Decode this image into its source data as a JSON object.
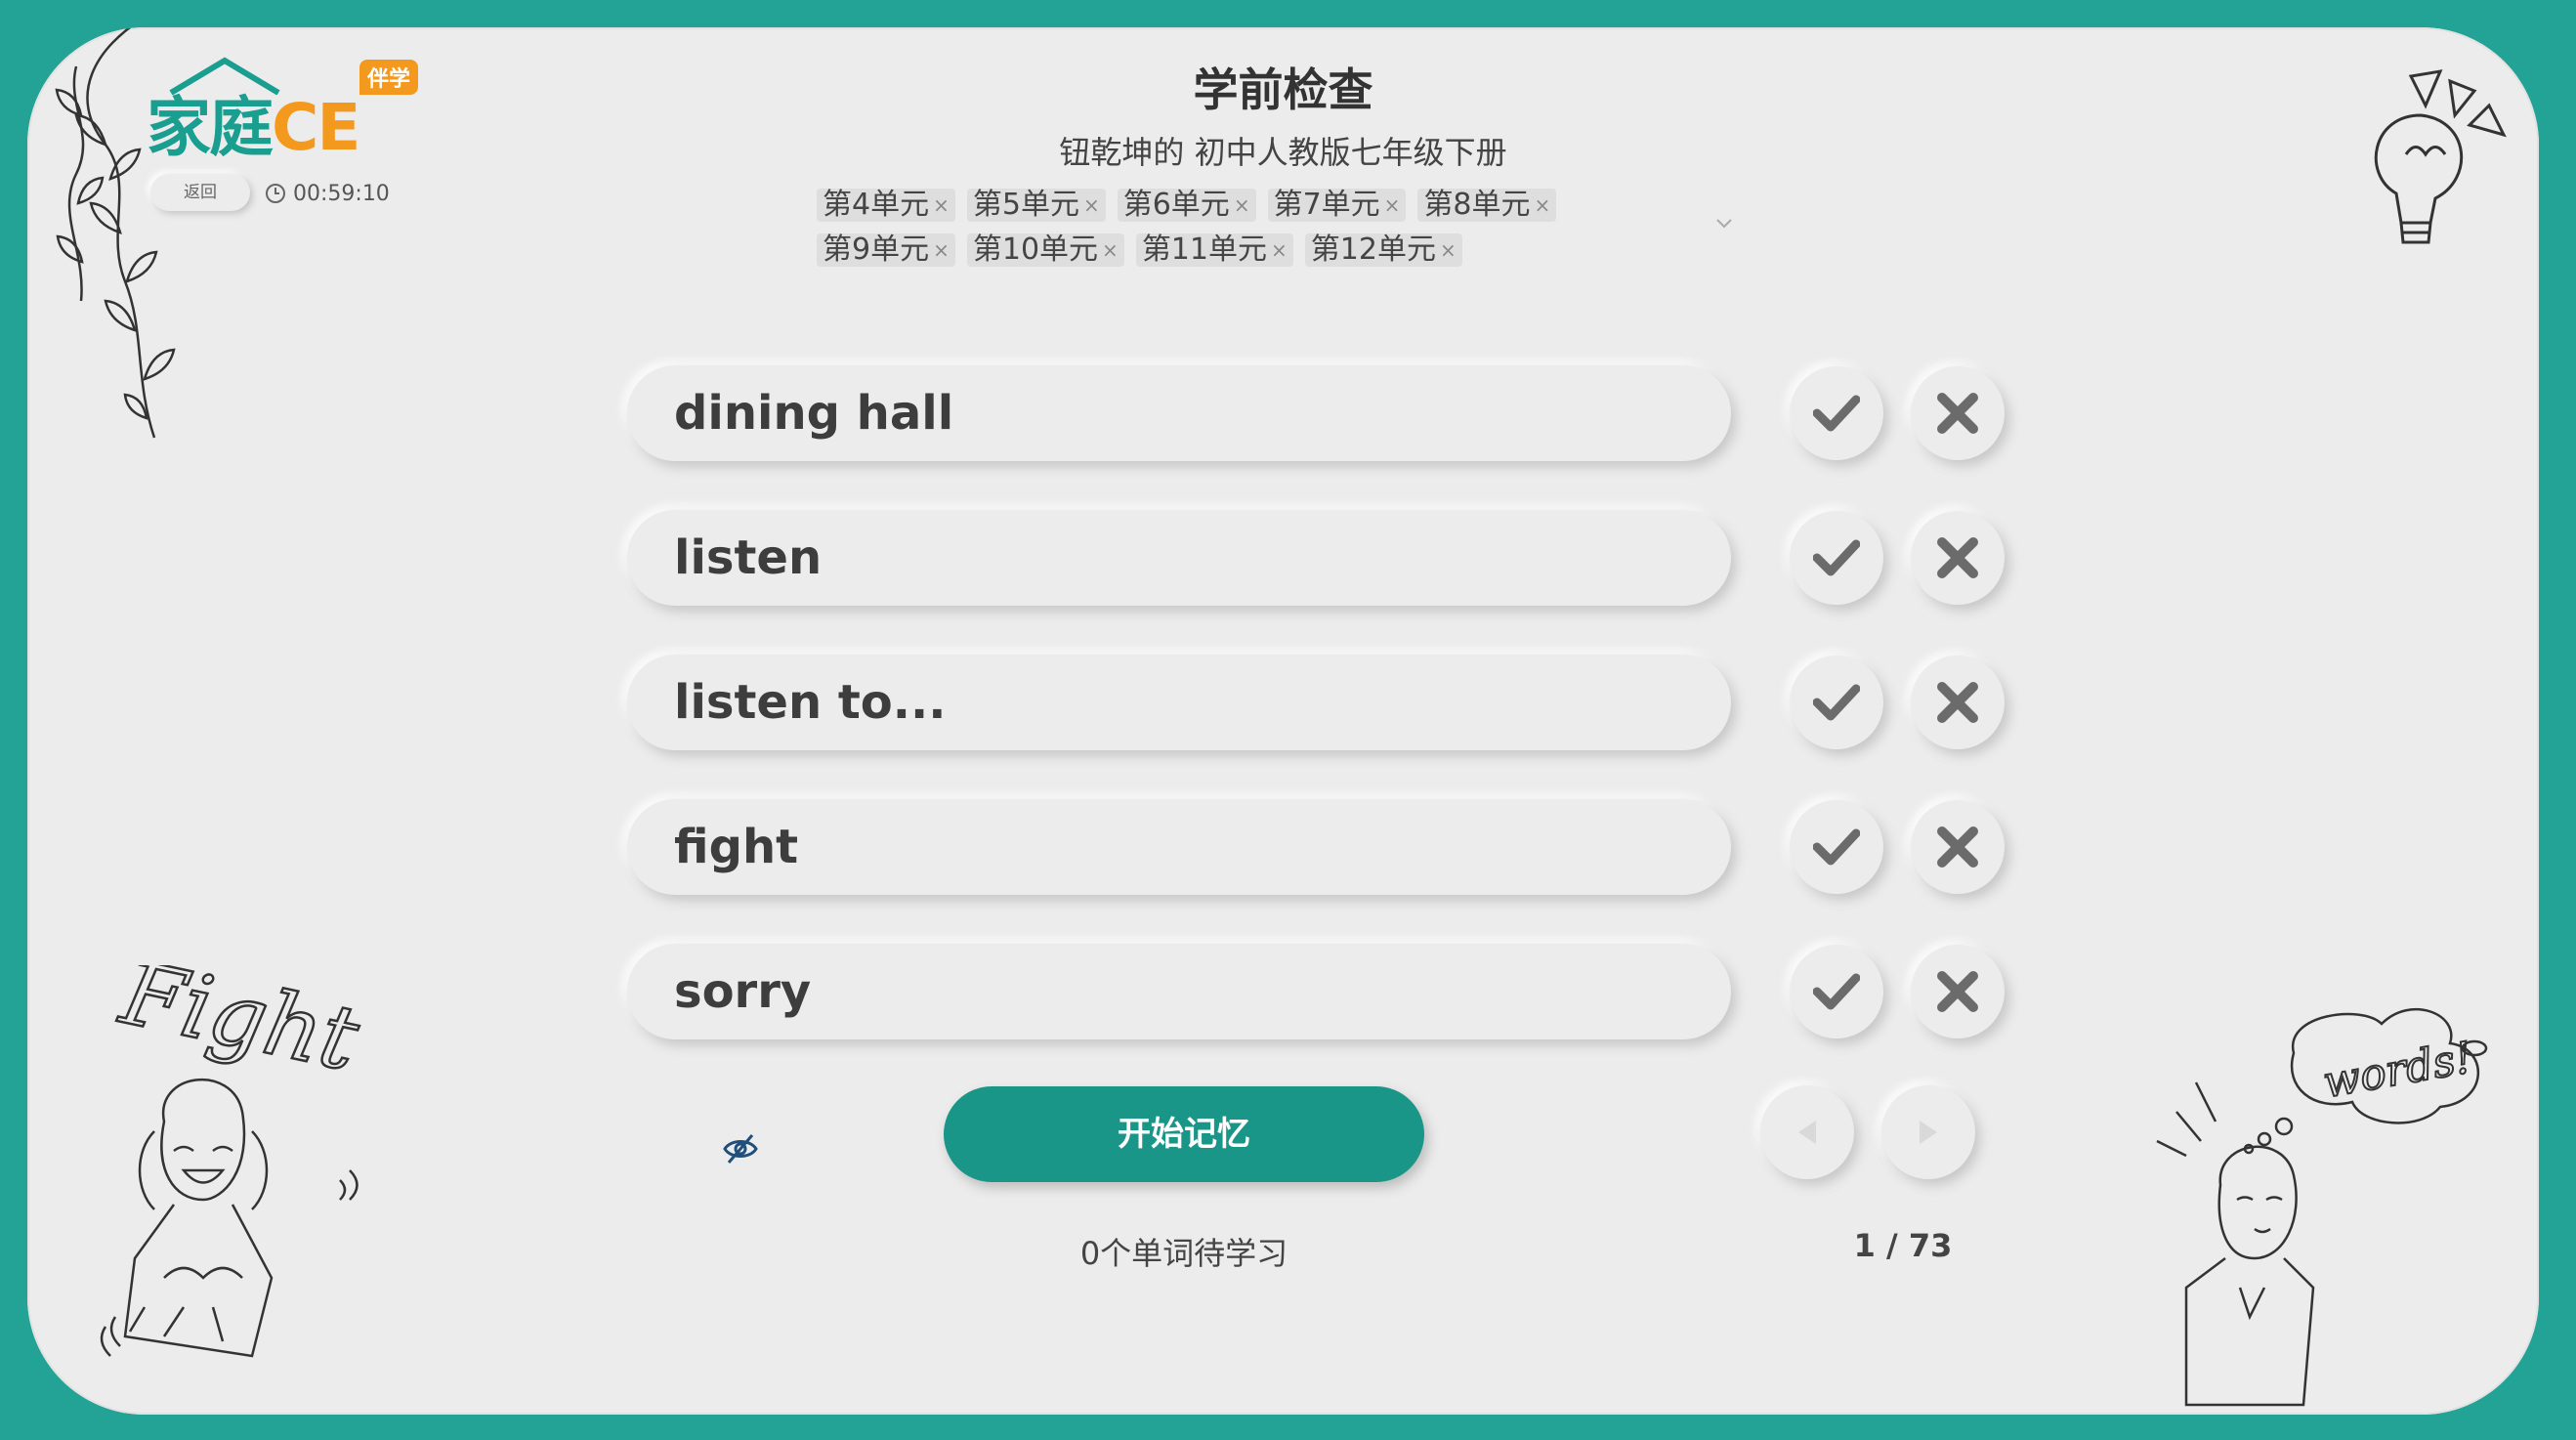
{
  "header": {
    "title": "学前检查",
    "subtitle": "钮乾坤的 初中人教版七年级下册",
    "back_label": "返回",
    "timer": "00:59:10",
    "logo_main": "家庭",
    "logo_ce": "CE",
    "logo_badge": "伴学"
  },
  "units": [
    {
      "label": "第4单元",
      "remove": "×"
    },
    {
      "label": "第5单元",
      "remove": "×"
    },
    {
      "label": "第6单元",
      "remove": "×"
    },
    {
      "label": "第7单元",
      "remove": "×"
    },
    {
      "label": "第8单元",
      "remove": "×"
    },
    {
      "label": "第9单元",
      "remove": "×"
    },
    {
      "label": "第10单元",
      "remove": "×"
    },
    {
      "label": "第11单元",
      "remove": "×"
    },
    {
      "label": "第12单元",
      "remove": "×"
    }
  ],
  "words": [
    {
      "text": "dining hall"
    },
    {
      "text": "listen"
    },
    {
      "text": "listen to..."
    },
    {
      "text": "fight"
    },
    {
      "text": "sorry"
    }
  ],
  "footer": {
    "start_label": "开始记忆",
    "pending_text": "0个单词待学习",
    "pager": "1 / 73"
  },
  "doodles": {
    "fight_text": "Fight",
    "words_text": "words!"
  },
  "colors": {
    "frame": "#22a396",
    "accent": "#1a9688",
    "logo_orange": "#f39a1e",
    "panel": "#ececec"
  },
  "icons": [
    "check-icon",
    "cross-icon",
    "eye-off-icon",
    "chevron-down-icon",
    "prev-arrow-icon",
    "next-arrow-icon",
    "clock-icon"
  ]
}
